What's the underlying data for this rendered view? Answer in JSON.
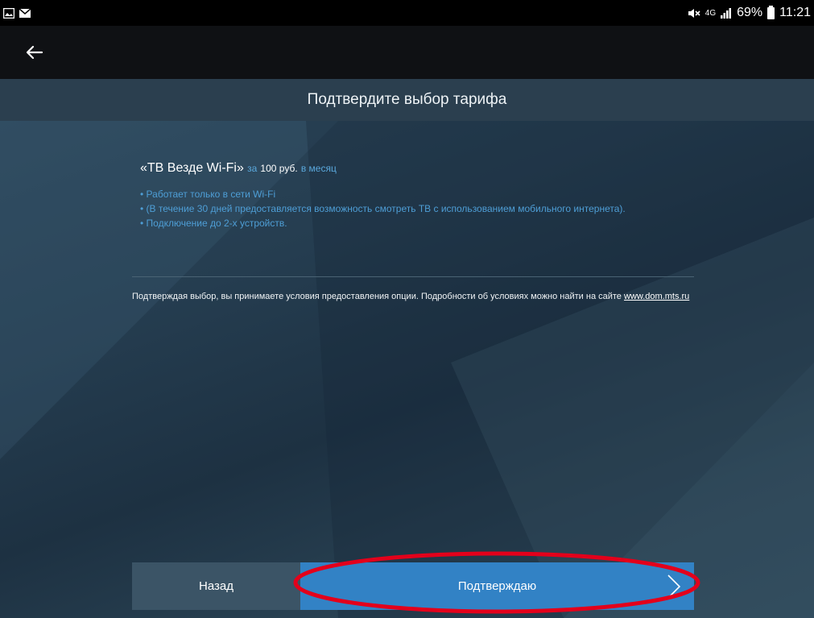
{
  "status_bar": {
    "network": "4G",
    "battery": "69%",
    "time": "11:21"
  },
  "header": {
    "title": "Подтвердите выбор тарифа"
  },
  "tariff": {
    "name": "«ТВ Везде Wi-Fi»",
    "price_prefix": "за",
    "price": "100 руб.",
    "period": "в месяц",
    "features": [
      "• Работает только в сети Wi-Fi",
      "• (В течение 30 дней предоставляется возможность смотреть ТВ с использованием мобильного интернета).",
      "• Подключение до 2-х устройств."
    ]
  },
  "note": {
    "text": "Подтверждая выбор, вы принимаете условия предоставления опции. Подробности об условиях можно найти на сайте",
    "link": "www.dom.mts.ru"
  },
  "buttons": {
    "back_label": "Назад",
    "confirm_label": "Подтверждаю"
  },
  "colors": {
    "accent": "#3282c5",
    "feature_text": "#4e9ed6",
    "annotation_ring": "#e3001b"
  }
}
